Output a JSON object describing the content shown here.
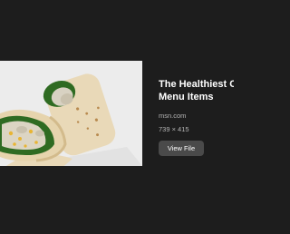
{
  "preview": {
    "image_icon": "wrap-sandwich-photo"
  },
  "details": {
    "title_line1": "The Healthiest Chicken",
    "title_line2": "Menu Items",
    "source": "msn.com",
    "dimensions": "739 × 415",
    "view_file_label": "View File"
  },
  "colors": {
    "background": "#1d1d1d",
    "button": "#4a4a4a",
    "text_primary": "#ffffff",
    "text_secondary": "#b4b4b4"
  }
}
